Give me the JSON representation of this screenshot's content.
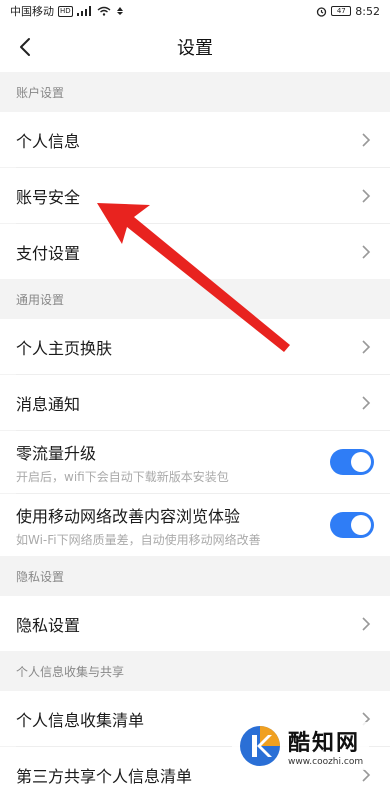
{
  "status": {
    "carrier": "中国移动",
    "hd": "HD",
    "battery": "47",
    "time": "8:52"
  },
  "nav": {
    "title": "设置"
  },
  "sections": {
    "account": {
      "header": "账户设置",
      "items": [
        "个人信息",
        "账号安全",
        "支付设置"
      ]
    },
    "general": {
      "header": "通用设置",
      "items": [
        "个人主页换肤",
        "消息通知"
      ],
      "toggles": [
        {
          "label": "零流量升级",
          "sub": "开启后，wifi下会自动下载新版本安装包",
          "on": true
        },
        {
          "label": "使用移动网络改善内容浏览体验",
          "sub": "如Wi-Fi下网络质量差，自动使用移动网络改善",
          "on": true
        }
      ]
    },
    "privacy": {
      "header": "隐私设置",
      "items": [
        "隐私设置"
      ]
    },
    "collection": {
      "header": "个人信息收集与共享",
      "items": [
        "个人信息收集清单",
        "第三方共享个人信息清单"
      ]
    }
  },
  "watermark": {
    "name": "酷知网",
    "url": "www.coozhi.com"
  },
  "colors": {
    "accent": "#2f7df6",
    "arrow": "#e8231f"
  }
}
